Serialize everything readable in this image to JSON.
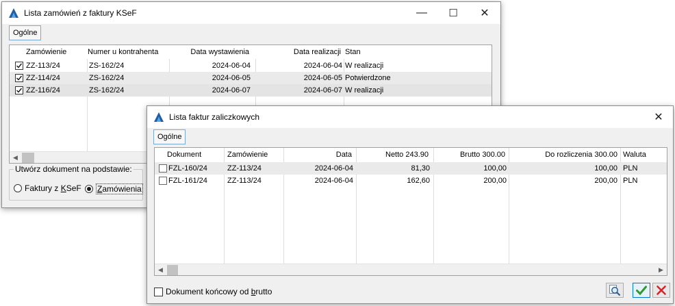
{
  "window1": {
    "title": "Lista zamówień z faktury KSeF",
    "tab": "Ogólne",
    "columns": [
      "Zamówienie",
      "Numer u kontrahenta",
      "Data wystawienia",
      "Data realizacji",
      "Stan"
    ],
    "rows": [
      {
        "checked": true,
        "zamowienie": "ZZ-113/24",
        "numer": "ZS-162/24",
        "data_wyst": "2024-06-04",
        "data_real": "2024-06-04",
        "stan": "W realizacji"
      },
      {
        "checked": true,
        "zamowienie": "ZZ-114/24",
        "numer": "ZS-162/24",
        "data_wyst": "2024-06-05",
        "data_real": "2024-06-05",
        "stan": "Potwierdzone"
      },
      {
        "checked": true,
        "zamowienie": "ZZ-116/24",
        "numer": "ZS-162/24",
        "data_wyst": "2024-06-07",
        "data_real": "2024-06-07",
        "stan": "W realizacji"
      }
    ],
    "group_title": "Utwórz dokument na podstawie:",
    "radio_faktury_pre": "Faktury z ",
    "radio_faktury_acc": "K",
    "radio_faktury_post": "SeF",
    "radio_zamowienia_acc": "Z",
    "radio_zamowienia_post": "amówienia",
    "selected_radio": "Zamówienia"
  },
  "window2": {
    "title": "Lista faktur zaliczkowych",
    "tab": "Ogólne",
    "columns": [
      "Dokument",
      "Zamówienie",
      "Data",
      "Netto 243.90",
      "Brutto 300.00",
      "Do rozliczenia 300.00",
      "Waluta"
    ],
    "rows": [
      {
        "checked": false,
        "dokument": "FZL-160/24",
        "zamowienie": "ZZ-113/24",
        "data": "2024-06-04",
        "netto": "81,30",
        "brutto": "100,00",
        "do_rozl": "100,00",
        "waluta": "PLN"
      },
      {
        "checked": false,
        "dokument": "FZL-161/24",
        "zamowienie": "ZZ-113/24",
        "data": "2024-06-04",
        "netto": "162,60",
        "brutto": "200,00",
        "do_rozl": "200,00",
        "waluta": "PLN"
      }
    ],
    "checkbox_pre": "Dokument końcowy od ",
    "checkbox_acc": "b",
    "checkbox_post": "rutto",
    "checkbox_checked": false
  },
  "colors": {
    "accent_blue": "#0078d7",
    "logo_blue": "#1f5fa6",
    "ok_green": "#2d9a2d",
    "cancel_red": "#d9232a"
  },
  "icons": {
    "minimize": "minimize-icon",
    "maximize": "maximize-icon",
    "close": "close-icon",
    "preview": "magnifier-icon",
    "ok": "checkmark-icon",
    "cancel": "x-icon"
  },
  "glyphs": {
    "minimize": "—",
    "maximize": "☐",
    "close": "✕",
    "arrow_left": "◀",
    "arrow_right": "▶"
  }
}
